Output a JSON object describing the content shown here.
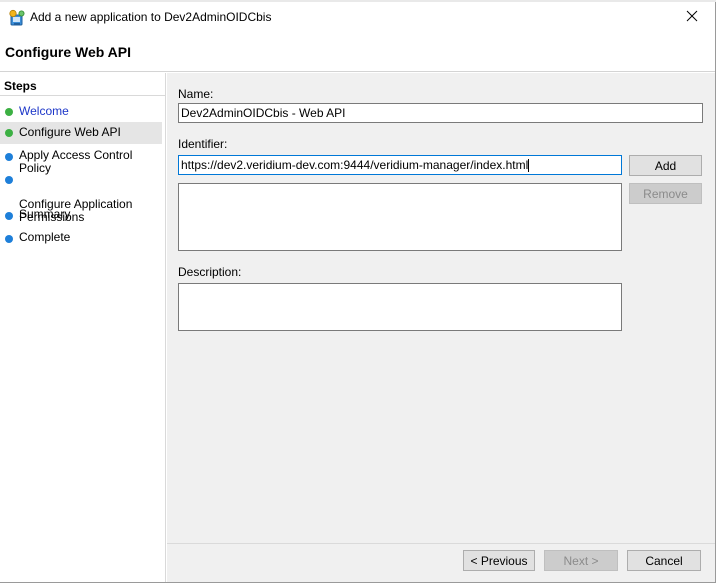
{
  "window": {
    "title": "Add a new application to Dev2AdminOIDCbis",
    "icon": "ad-fs-application-icon",
    "close_glyph": "✕"
  },
  "header": {
    "title": "Configure Web API"
  },
  "steps": {
    "heading": "Steps",
    "items": [
      {
        "label": "Welcome",
        "status": "complete",
        "dot_color": "#3cb043"
      },
      {
        "label": "Configure Web API",
        "status": "current",
        "dot_color": "#3cb043"
      },
      {
        "label": "Apply Access Control Policy",
        "status": "pending",
        "dot_color": "#1e7fd9"
      },
      {
        "label": "Configure Application\nPermissions",
        "status": "pending",
        "dot_color": "#1e7fd9"
      },
      {
        "label": "Summary",
        "status": "pending",
        "dot_color": "#1e7fd9"
      },
      {
        "label": "Complete",
        "status": "pending",
        "dot_color": "#1e7fd9"
      }
    ]
  },
  "form": {
    "name_label": "Name:",
    "name_value": "Dev2AdminOIDCbis - Web API",
    "identifier_label": "Identifier:",
    "identifier_value": "https://dev2.veridium-dev.com:9444/veridium-manager/index.html",
    "add_label": "Add",
    "remove_label": "Remove",
    "identifier_list": [],
    "description_label": "Description:",
    "description_value": ""
  },
  "footer": {
    "previous_label": "< Previous",
    "next_label": "Next >",
    "cancel_label": "Cancel"
  }
}
